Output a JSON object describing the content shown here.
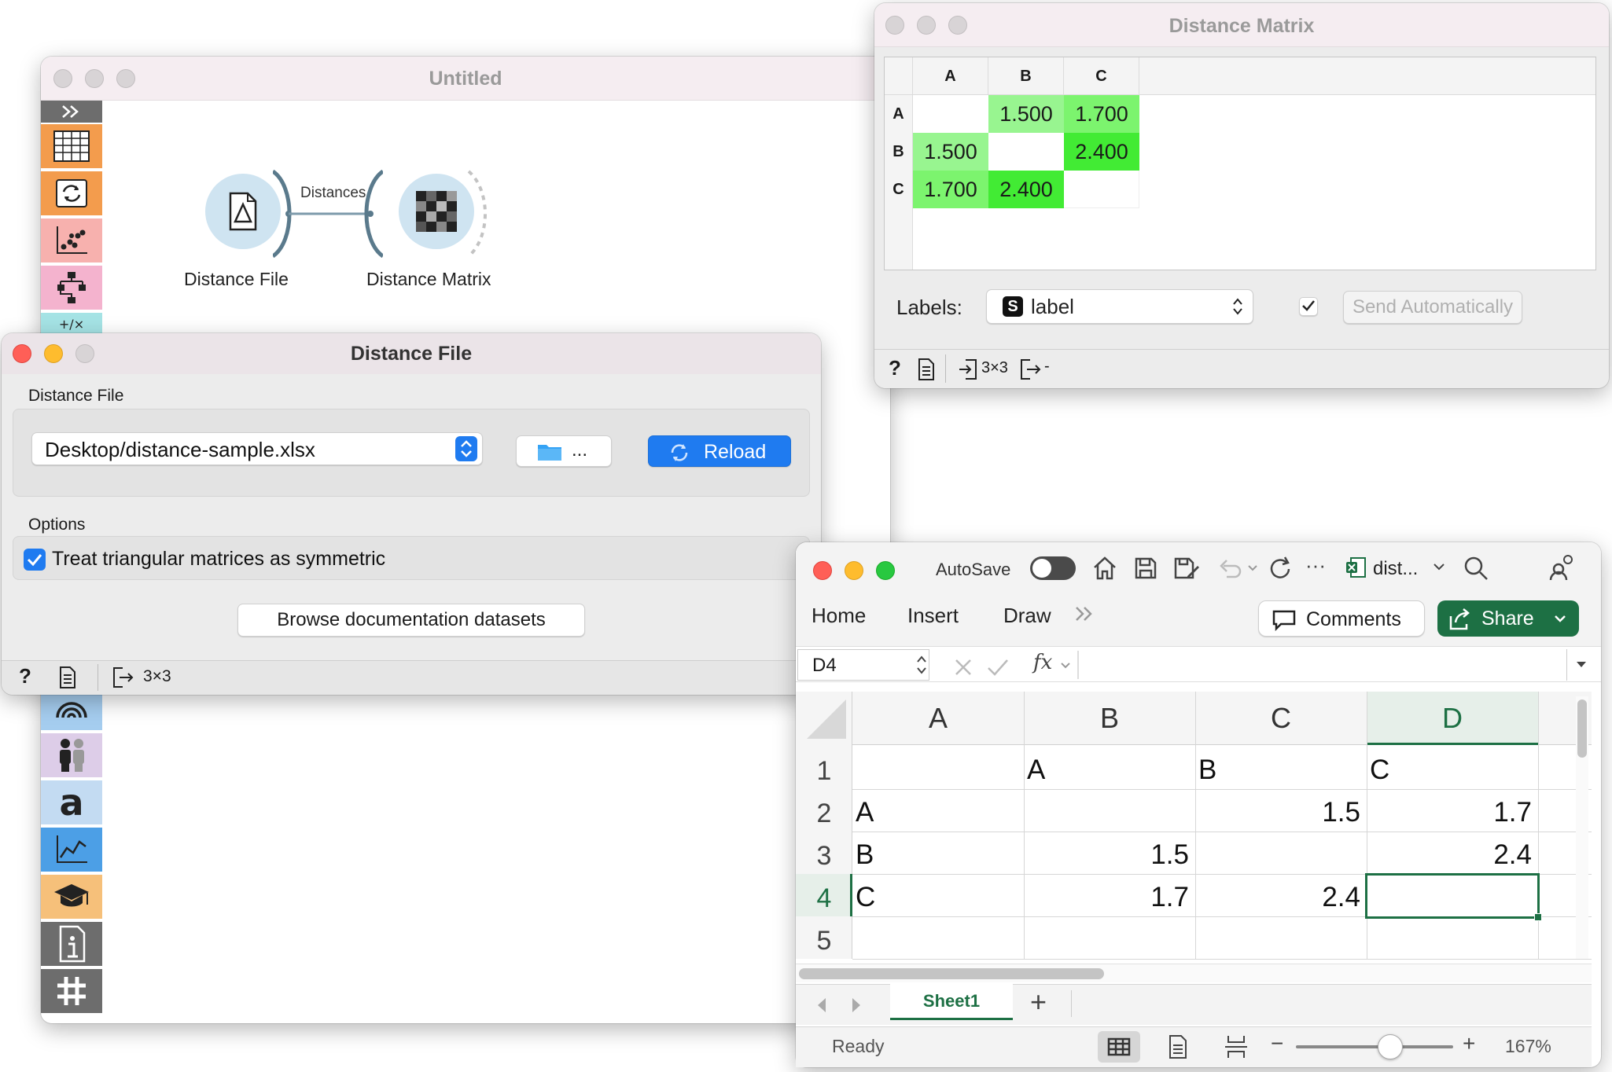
{
  "canvas": {
    "title": "Untitled",
    "widgets": [
      {
        "label": "Distance File"
      },
      {
        "label": "Distance Matrix"
      }
    ],
    "link_label": "Distances",
    "toolbox_icons": [
      "expand-icon",
      "table-icon",
      "transform-icon",
      "scatter-icon",
      "tree-icon",
      "formula-icon",
      "radar-icon",
      "people-icon",
      "text-a-icon",
      "line-chart-icon",
      "graduation-cap-icon",
      "info-icon",
      "hash-icon"
    ],
    "toolbox_colors": {
      "orange": "#f39c4d",
      "red": "#f7b1ae",
      "pink": "#f4b3ce",
      "purple": "#ddcde8",
      "blue": "#a5cdef",
      "gray": "#6d6d6d"
    }
  },
  "distance_matrix": {
    "title": "Distance Matrix",
    "col_headers": [
      "A",
      "B",
      "C"
    ],
    "row_headers": [
      "A",
      "B",
      "C"
    ],
    "cells": [
      [
        "",
        "1.500",
        "1.700"
      ],
      [
        "1.500",
        "",
        "2.400"
      ],
      [
        "1.700",
        "2.400",
        ""
      ]
    ],
    "labels_label": "Labels:",
    "labels_value": "label",
    "labels_badge": "S",
    "send_automatically": "Send Automatically",
    "send_checked": true,
    "status_in": "3×3",
    "status_out": "-",
    "colors": {
      "light_green": "#98f590",
      "mid_green": "#7cf46e",
      "bright_green": "#42eb34"
    }
  },
  "distance_file": {
    "title": "Distance File",
    "section_file": "Distance File",
    "file_path": "Desktop/distance-sample.xlsx",
    "browse_label": "...",
    "reload_label": "Reload",
    "section_options": "Options",
    "symmetric_label": "Treat triangular matrices as symmetric",
    "symmetric_checked": true,
    "browse_docs_label": "Browse documentation datasets",
    "status_out": "3×3"
  },
  "excel": {
    "autosave_label": "AutoSave",
    "file_name": "dist...",
    "tabs": [
      "Home",
      "Insert",
      "Draw"
    ],
    "comments_label": "Comments",
    "share_label": "Share",
    "name_box": "D4",
    "fx_label": "fx",
    "formula_value": "",
    "columns": [
      "A",
      "B",
      "C",
      "D"
    ],
    "rows": [
      "1",
      "2",
      "3",
      "4",
      "5"
    ],
    "cells": [
      [
        "",
        "A",
        "B",
        "C"
      ],
      [
        "A",
        "",
        "1.5",
        "1.7"
      ],
      [
        "B",
        "1.5",
        "",
        "2.4"
      ],
      [
        "C",
        "1.7",
        "2.4",
        ""
      ],
      [
        "",
        "",
        "",
        ""
      ]
    ],
    "active_cell": "D4",
    "sheet_tab": "Sheet1",
    "status": "Ready",
    "zoom": "167%",
    "accent": "#1d7044"
  }
}
